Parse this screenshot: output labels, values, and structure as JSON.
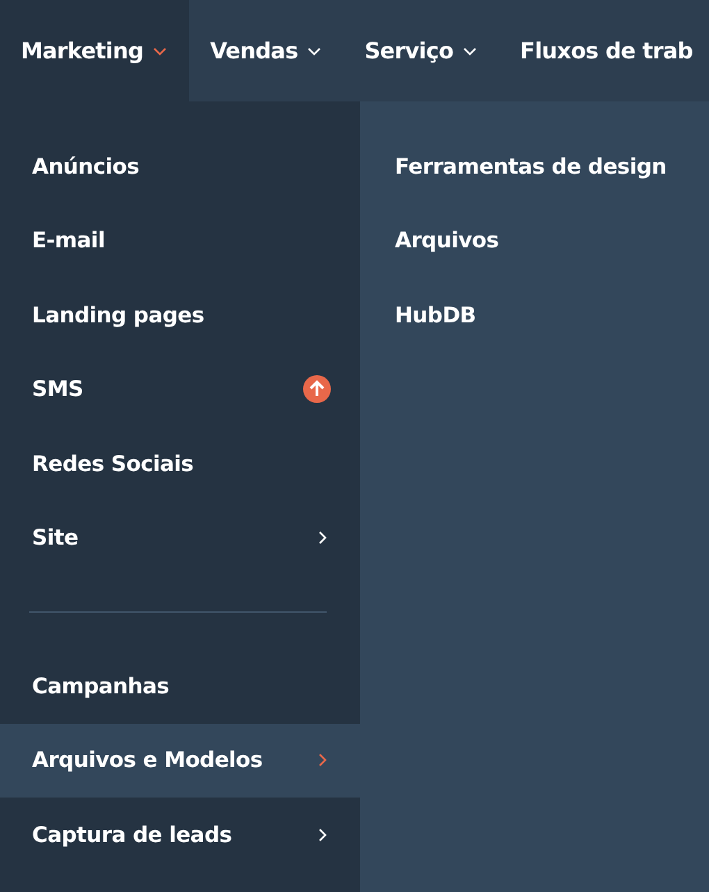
{
  "nav": [
    {
      "label": "Marketing",
      "selected": true,
      "caret": true
    },
    {
      "label": "Vendas",
      "selected": false,
      "caret": true
    },
    {
      "label": "Serviço",
      "selected": false,
      "caret": true
    },
    {
      "label": "Fluxos de trab",
      "selected": false,
      "caret": false
    }
  ],
  "menu": {
    "groups": [
      [
        {
          "label": "Anúncios",
          "kind": "plain",
          "selected": false
        },
        {
          "label": "E-mail",
          "kind": "plain",
          "selected": false
        },
        {
          "label": "Landing pages",
          "kind": "plain",
          "selected": false
        },
        {
          "label": "SMS",
          "kind": "upgrade",
          "selected": false
        },
        {
          "label": "Redes Sociais",
          "kind": "plain",
          "selected": false
        },
        {
          "label": "Site",
          "kind": "submenu",
          "selected": false
        }
      ],
      [
        {
          "label": "Campanhas",
          "kind": "plain",
          "selected": false
        },
        {
          "label": "Arquivos e Modelos",
          "kind": "submenu",
          "selected": true
        },
        {
          "label": "Captura de leads",
          "kind": "submenu",
          "selected": false
        }
      ]
    ]
  },
  "submenu": {
    "items": [
      {
        "label": "Ferramentas de design"
      },
      {
        "label": "Arquivos"
      },
      {
        "label": "HubDB"
      }
    ]
  }
}
